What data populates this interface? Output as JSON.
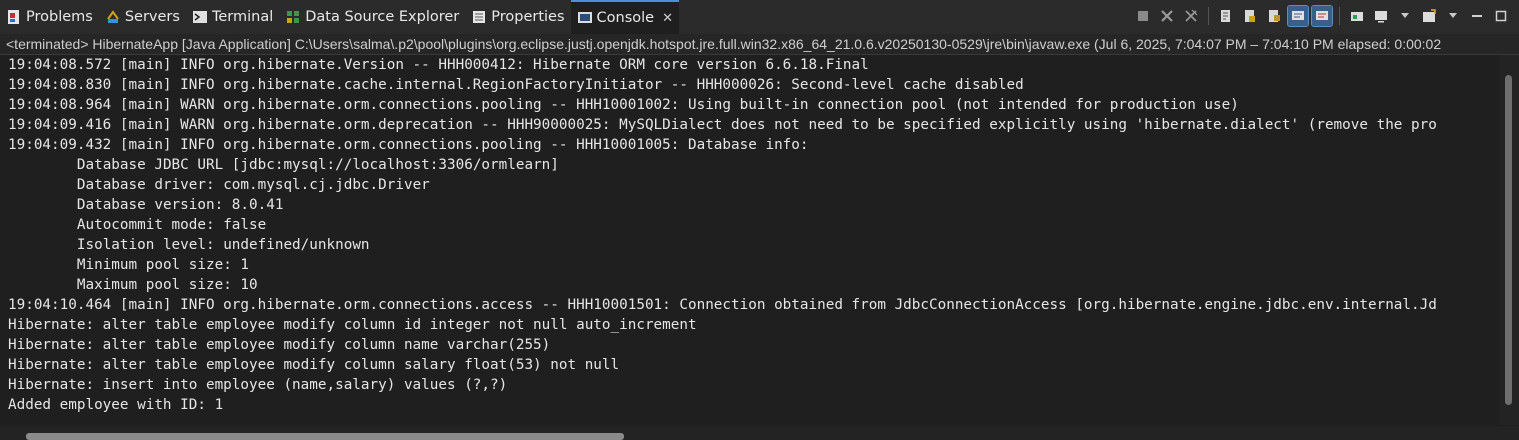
{
  "tabs": [
    {
      "label": "Problems",
      "icon": "problems-icon"
    },
    {
      "label": "Servers",
      "icon": "servers-icon"
    },
    {
      "label": "Terminal",
      "icon": "terminal-icon"
    },
    {
      "label": "Data Source Explorer",
      "icon": "data-source-icon"
    },
    {
      "label": "Properties",
      "icon": "properties-icon"
    },
    {
      "label": "Console",
      "icon": "console-icon",
      "active": true
    }
  ],
  "toolbar": {
    "close_glyph": "✕"
  },
  "status": {
    "text": "<terminated> HibernateApp [Java Application] C:\\Users\\salma\\.p2\\pool\\plugins\\org.eclipse.justj.openjdk.hotspot.jre.full.win32.x86_64_21.0.6.v20250130-0529\\jre\\bin\\javaw.exe  (Jul 6, 2025, 7:04:07 PM – 7:04:10 PM elapsed: 0:00:02"
  },
  "console_lines": [
    "19:04:08.572 [main] INFO org.hibernate.Version -- HHH000412: Hibernate ORM core version 6.6.18.Final",
    "19:04:08.830 [main] INFO org.hibernate.cache.internal.RegionFactoryInitiator -- HHH000026: Second-level cache disabled",
    "19:04:08.964 [main] WARN org.hibernate.orm.connections.pooling -- HHH10001002: Using built-in connection pool (not intended for production use)",
    "19:04:09.416 [main] WARN org.hibernate.orm.deprecation -- HHH90000025: MySQLDialect does not need to be specified explicitly using 'hibernate.dialect' (remove the pro",
    "19:04:09.432 [main] INFO org.hibernate.orm.connections.pooling -- HHH10001005: Database info:",
    "\tDatabase JDBC URL [jdbc:mysql://localhost:3306/ormlearn]",
    "\tDatabase driver: com.mysql.cj.jdbc.Driver",
    "\tDatabase version: 8.0.41",
    "\tAutocommit mode: false",
    "\tIsolation level: undefined/unknown",
    "\tMinimum pool size: 1",
    "\tMaximum pool size: 10",
    "19:04:10.464 [main] INFO org.hibernate.orm.connections.access -- HHH10001501: Connection obtained from JdbcConnectionAccess [org.hibernate.engine.jdbc.env.internal.Jd",
    "Hibernate: alter table employee modify column id integer not null auto_increment",
    "Hibernate: alter table employee modify column name varchar(255)",
    "Hibernate: alter table employee modify column salary float(53) not null",
    "Hibernate: insert into employee (name,salary) values (?,?)",
    "Added employee with ID: 1"
  ],
  "colors": {
    "background": "#1f1f1f",
    "text": "#e6e6e6",
    "active_tab_accent": "#4a90d9"
  }
}
